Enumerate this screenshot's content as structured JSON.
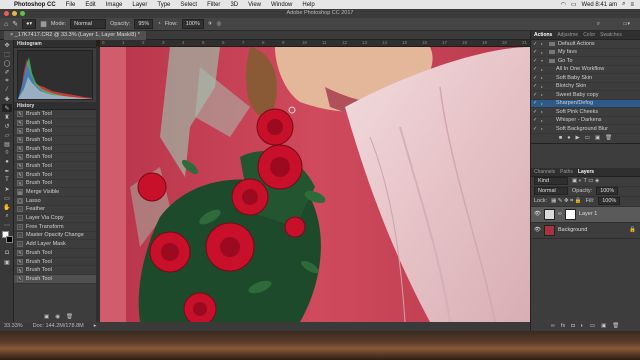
{
  "macbar": {
    "app": "Photoshop CC",
    "menus": [
      "File",
      "Edit",
      "Image",
      "Layer",
      "Type",
      "Select",
      "Filter",
      "3D",
      "View",
      "Window",
      "Help"
    ],
    "clock": "Wed 8:41 am"
  },
  "titlebar": {
    "title": "Adobe Photoshop CC 2017"
  },
  "options": {
    "mode_label": "Mode:",
    "mode_value": "Normal",
    "opacity_label": "Opacity:",
    "opacity_value": "95%",
    "flow_label": "Flow:",
    "flow_value": "100%"
  },
  "document": {
    "tab": "_17K7417.CR2 @ 33.3% (Layer 1, Layer Mask/8) *"
  },
  "ruler": [
    "0",
    "1",
    "2",
    "3",
    "4",
    "5",
    "6",
    "7",
    "8",
    "9",
    "10",
    "11",
    "12",
    "13",
    "14",
    "15",
    "16",
    "17",
    "18",
    "19",
    "20",
    "21"
  ],
  "histogram": {
    "title": "Histogram"
  },
  "history": {
    "title": "History",
    "items": [
      "Brush Tool",
      "Brush Tool",
      "Brush Tool",
      "Brush Tool",
      "Brush Tool",
      "Brush Tool",
      "Brush Tool",
      "Brush Tool",
      "Brush Tool",
      "Merge Visible",
      "Lasso",
      "Feather",
      "Layer Via Copy",
      "Free Transform",
      "Master Opacity Change",
      "Add Layer Mask",
      "Brush Tool",
      "Brush Tool",
      "Brush Tool",
      "Brush Tool"
    ]
  },
  "actions": {
    "tabs": [
      "Actions",
      "Adjustme",
      "Color",
      "Swatches"
    ],
    "items": [
      "Default Actions",
      "My favs",
      "Go To",
      "All In One Workflow",
      "Soft Baby Skin",
      "Blotchy Skin",
      "Sweet Baby copy",
      "Sharpen/Defog",
      "Soft Pink Cheeks",
      "Whisper - Darkens",
      "Soft Background Blur"
    ]
  },
  "layers": {
    "tabs": [
      "Channels",
      "Paths",
      "Layers"
    ],
    "kind": "Kind",
    "blend": "Normal",
    "opacity_label": "Opacity:",
    "opacity_value": "100%",
    "lock_label": "Lock:",
    "fill_label": "Fill:",
    "fill_value": "100%",
    "items": [
      "Layer 1",
      "Background"
    ]
  },
  "status": {
    "zoom": "33.33%",
    "doc": "Doc: 144.2M/178.8M"
  }
}
